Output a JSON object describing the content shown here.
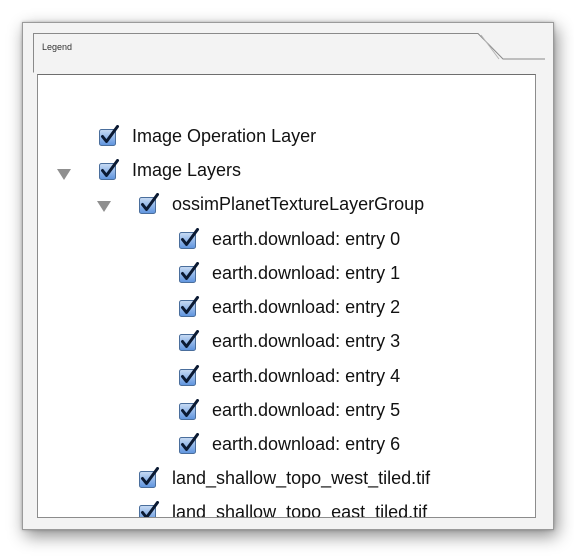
{
  "legend": {
    "tab_label": "Legend"
  },
  "colors": {
    "checkbox_fill_top": "#c9dcf4",
    "checkbox_fill_bottom": "#5d93de",
    "checkmark": "#0b1a33",
    "disclosure": "#8f8f8f"
  },
  "tree": {
    "items": [
      {
        "label": "Image Operation Layer",
        "checked": true
      },
      {
        "label": "Image Layers",
        "checked": true,
        "expanded": true
      },
      {
        "label": "ossimPlanetTextureLayerGroup",
        "checked": true,
        "expanded": true
      },
      {
        "label": "earth.download: entry 0",
        "checked": true
      },
      {
        "label": "earth.download: entry 1",
        "checked": true
      },
      {
        "label": "earth.download: entry 2",
        "checked": true
      },
      {
        "label": "earth.download: entry 3",
        "checked": true
      },
      {
        "label": "earth.download: entry 4",
        "checked": true
      },
      {
        "label": "earth.download: entry 5",
        "checked": true
      },
      {
        "label": "earth.download: entry 6",
        "checked": true
      },
      {
        "label": "land_shallow_topo_west_tiled.tif",
        "checked": true
      },
      {
        "label": "land_shallow_topo_east_tiled.tif",
        "checked": true
      }
    ]
  }
}
